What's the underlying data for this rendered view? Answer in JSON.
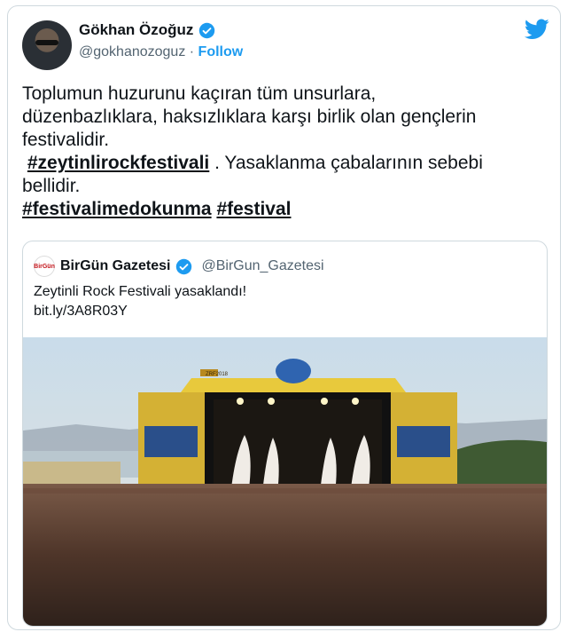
{
  "tweet": {
    "author_name": "Gökhan Özoğuz",
    "author_handle": "@gokhanozoguz",
    "separator": " · ",
    "follow_label": "Follow",
    "text_line1": "Toplumun huzurunu kaçıran tüm unsurlara,",
    "text_line2": "düzenbazlıklara, haksızlıklara karşı birlik olan gençlerin",
    "text_line3": "festivalidir.",
    "hashtag1": "#zeytinlirockfestivali",
    "text_after_hashtag1": " . Yasaklanma çabalarının sebebi",
    "text_line5": "bellidir.",
    "hashtag2": "#festivalimedokunma",
    "hashtag3": "#festival"
  },
  "quote": {
    "logo_text": "BirGün",
    "author_name": "BirGün Gazetesi",
    "author_handle": "@BirGun_Gazetesi",
    "text": "Zeytinli Rock Festivali yasaklandı!",
    "link": "bit.ly/3A8R03Y",
    "stage_banner": "ZRF2018"
  },
  "colors": {
    "accent": "#1d9bf0",
    "text": "#0f1419",
    "secondary": "#536471",
    "border": "#cfd9de"
  },
  "icons": [
    "verified-badge-icon",
    "twitter-bird-icon"
  ]
}
